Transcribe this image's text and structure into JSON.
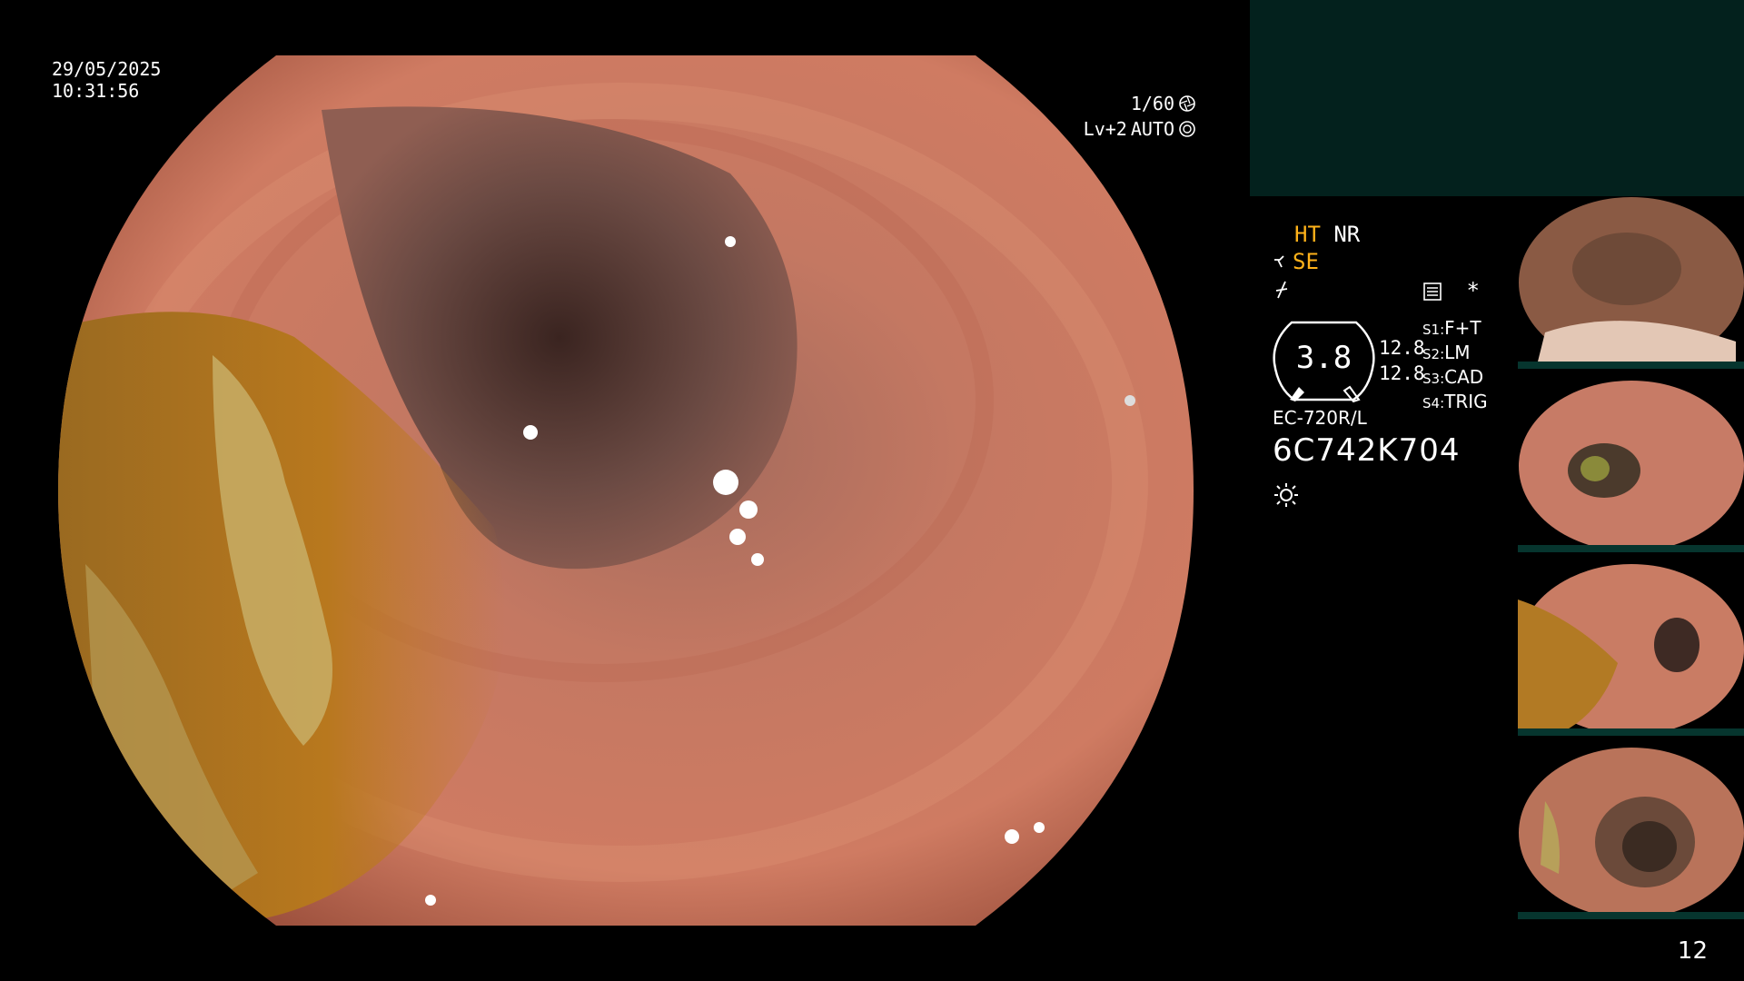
{
  "overlay": {
    "date": "29/05/2025",
    "time": "10:31:56",
    "shutter": "1/60",
    "shutter_icon": "aperture-icon",
    "exposure_level": "Lv+2",
    "exposure_mode": "AUTO",
    "exposure_icon": "iris-icon"
  },
  "panel": {
    "mode_ht": "HT",
    "mode_nr": "NR",
    "mode_se": "SE",
    "dial_value": "3.8",
    "values": [
      "12.8",
      "12.8"
    ],
    "switches": [
      {
        "key": "S1:",
        "value": "F+T"
      },
      {
        "key": "S2:",
        "value": "LM"
      },
      {
        "key": "S3:",
        "value": "CAD"
      },
      {
        "key": "S4:",
        "value": "TRIG"
      }
    ],
    "asterisk": "*",
    "scope_model": "EC-720R/L",
    "scope_serial": "6C742K704",
    "highlight_color": "#ffb21a"
  },
  "thumbnails": [
    {
      "label": "captured-image-1"
    },
    {
      "label": "captured-image-2"
    },
    {
      "label": "captured-image-3"
    },
    {
      "label": "captured-image-4"
    }
  ],
  "page_number": "12"
}
